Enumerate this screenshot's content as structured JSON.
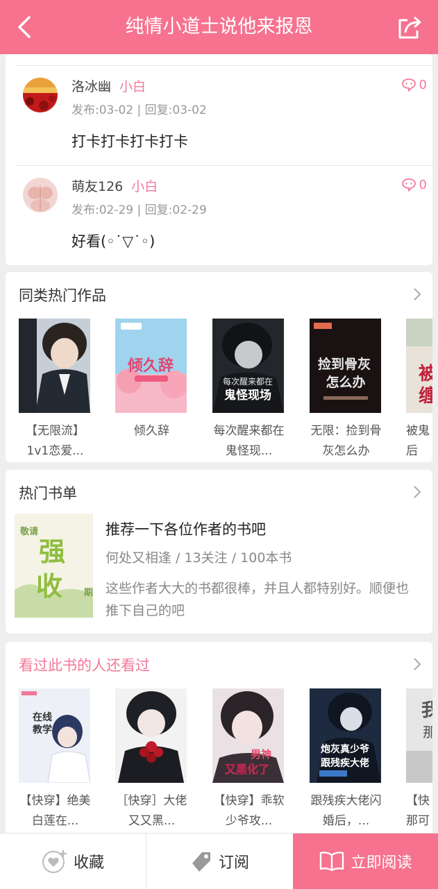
{
  "header": {
    "title": "纯情小道士说他来报恩",
    "back_icon": "back-arrow-icon",
    "share_icon": "share-icon"
  },
  "comments": [
    {
      "user": "洛冰幽",
      "level": "小白",
      "meta": "发布:03-02 | 回复:03-02",
      "text": "打卡打卡打卡打卡",
      "replies": "0"
    },
    {
      "user": "萌友126",
      "level": "小白",
      "meta": "发布:02-29 | 回复:02-29",
      "text": "好看(◦˙▽˙◦)",
      "replies": "0"
    }
  ],
  "similar": {
    "title": "同类热门作品",
    "books": [
      {
        "title": "【无限流】1v1恋爱..."
      },
      {
        "title": "倾久辞",
        "cover_text": "倾久辞"
      },
      {
        "title": "每次醒来都在鬼怪现...",
        "cover_text": "每次醒来都在 鬼怪现场"
      },
      {
        "title": "无限：捡到骨灰怎么办",
        "cover_text": "捡到骨灰 怎么办"
      },
      {
        "title": "被鬼后",
        "cover_text": "被 缠"
      }
    ]
  },
  "booklist": {
    "title": "热门书单",
    "name": "推荐一下各位作者的书吧",
    "meta": "何处又相逢 / 13关注 / 100本书",
    "desc": "这些作者大大的书都很棒，并且人都特别好。顺便也推下自己的吧",
    "cover_text": "强制收"
  },
  "also_read": {
    "title": "看过此书的人还看过",
    "books": [
      {
        "title": "【快穿】绝美白莲在...",
        "cover_text": "在线教学"
      },
      {
        "title": "［快穿］大佬又又黑..."
      },
      {
        "title": "【快穿】乖软少爷攻...",
        "cover_text": "男神 又黑化了"
      },
      {
        "title": "跟残疾大佬闪婚后，...",
        "cover_text": "炮灰真少爷 跟残疾大佬"
      },
      {
        "title": "【快那可",
        "cover_text": "我 那"
      }
    ]
  },
  "bottom": {
    "collect": "收藏",
    "subscribe": "订阅",
    "read": "立即阅读"
  },
  "colors": {
    "accent": "#f6728f",
    "pink_text": "#f4789a"
  }
}
